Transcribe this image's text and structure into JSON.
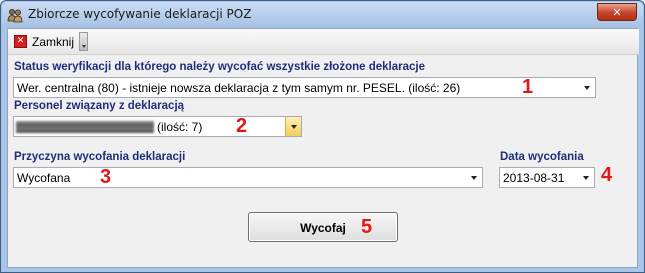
{
  "window": {
    "title": "Zbiorcze wycofywanie deklaracji POZ",
    "accent_color": "#a9c4e6",
    "close_color": "#c4452a"
  },
  "toolbar": {
    "close_label": "Zamknij",
    "close_icon": "red-x-icon"
  },
  "status_field": {
    "label": "Status weryfikacji dla którego należy wycofać wszystkie złożone deklaracje",
    "value": "Wer. centralna (80) - istnieje nowsza deklaracja z tym samym nr. PESEL. (ilość: 26)",
    "marker": "1"
  },
  "personnel_field": {
    "label": "Personel związany z deklaracją",
    "value_visible": "(ilość: 7)",
    "marker": "2"
  },
  "reason_field": {
    "label": "Przyczyna wycofania deklaracji",
    "value": "Wycofana",
    "marker": "3"
  },
  "date_field": {
    "label": "Data wycofania",
    "value": "2013-08-31",
    "marker": "4"
  },
  "submit": {
    "label": "Wycofaj",
    "marker": "5"
  },
  "colors": {
    "label_text": "#1f2d7a",
    "marker_red": "#e01818"
  }
}
